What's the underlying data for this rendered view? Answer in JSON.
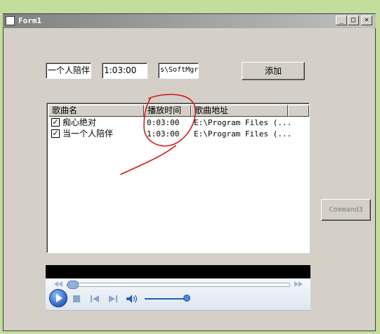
{
  "window": {
    "title": "Form1",
    "titlebar_buttons": [
      "_",
      "□",
      "×"
    ]
  },
  "inputs": {
    "song_name": "一个人陪伴",
    "duration": "1:03:00",
    "path": "s\\SoftMgr"
  },
  "buttons": {
    "add": "添加",
    "command3": "Command3"
  },
  "listview": {
    "columns": [
      "歌曲名",
      "播放时间",
      "歌曲地址"
    ],
    "rows": [
      {
        "checked": true,
        "name": "痴心绝对",
        "time": "0:03:00",
        "path": "E:\\Program Files (..."
      },
      {
        "checked": true,
        "name": "当一个人陪伴",
        "time": "1:03:00",
        "path": "E:\\Program Files (..."
      }
    ]
  },
  "player": {
    "seek_progress": 0,
    "volume_level": 0.88
  },
  "colors": {
    "desktop": "#c2dd9c",
    "window": "#d4d0c8",
    "annotation": "#d11a1a"
  }
}
